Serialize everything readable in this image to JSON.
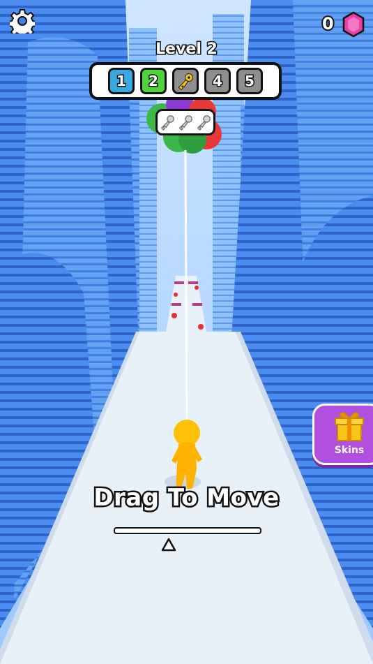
{
  "hud": {
    "gem_count": "0",
    "level_title": "Level 2",
    "levels": [
      {
        "label": "1",
        "state": "done"
      },
      {
        "label": "2",
        "state": "current"
      },
      {
        "label": "",
        "state": "key"
      },
      {
        "label": "4",
        "state": "locked"
      },
      {
        "label": "5",
        "state": "locked"
      }
    ],
    "keys_collected": 0,
    "keys_total": 3
  },
  "skins_button": {
    "label": "Skins"
  },
  "tutorial": {
    "text": "Drag To Move"
  },
  "colors": {
    "sky": "#3f7fe8",
    "building": "#4a8cf0",
    "road": "#e8f0f8",
    "player": "#ffc107",
    "level_done": "#38a8e0",
    "level_current": "#4ed13a",
    "level_locked": "#8e8e8e",
    "skins_bg": "#b24fe0",
    "gem": "#e83ea8"
  },
  "icons": {
    "settings": "gear-icon",
    "gem": "gem-icon",
    "key": "key-icon",
    "gift": "gift-icon"
  }
}
